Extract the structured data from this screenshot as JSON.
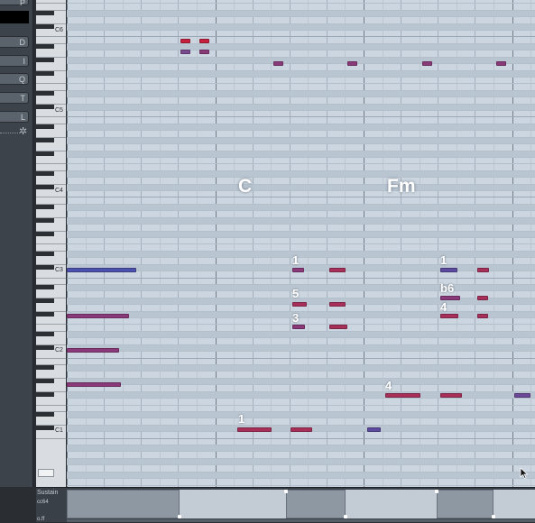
{
  "toolbar": {
    "buttons": [
      {
        "name": "pointer",
        "glyph": "P"
      },
      {
        "name": "draw",
        "glyph": "D"
      },
      {
        "name": "select",
        "glyph": "I"
      },
      {
        "name": "quantize",
        "glyph": "Q"
      },
      {
        "name": "text",
        "glyph": "T"
      },
      {
        "name": "length",
        "glyph": "L"
      }
    ],
    "settings_icon": "gear-icon"
  },
  "keyboard": {
    "octave_labels": [
      "C6",
      "C5",
      "C4",
      "C3",
      "C2",
      "C1"
    ]
  },
  "chords": [
    "C",
    "Fm"
  ],
  "degrees": [
    "1",
    "5",
    "3",
    "1",
    "1",
    "b6",
    "4",
    "4"
  ],
  "automation": {
    "lane_name": "Sustain",
    "cc_label": "cc64",
    "bottom_label": "o.ff"
  },
  "colors": {
    "grid_bg": "#ccd6e0",
    "note_red": "#c8203c",
    "note_crimson": "#a83058",
    "note_purple": "#8a3a78",
    "note_violet": "#5a4aa0",
    "note_blue": "#4a52b0",
    "text_white": "#ffffff"
  }
}
